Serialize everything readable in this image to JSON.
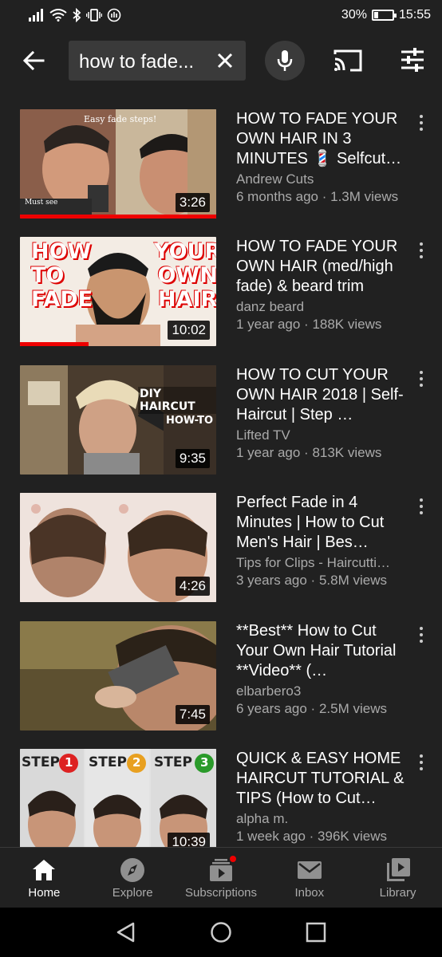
{
  "status_bar": {
    "signal": "4G",
    "battery_percent_label": "30%",
    "battery_level": 0.3,
    "time": "15:55"
  },
  "search": {
    "query": "how to fade..."
  },
  "results": [
    {
      "title": "HOW TO FADE YOUR OWN HAIR IN 3 MINUTES 💈 Selfcut…",
      "channel": "Andrew Cuts",
      "meta": "6 months ago · 1.3M views",
      "duration": "3:26",
      "watched_fraction": 1.0,
      "thumb_overlay": [
        "Easy fade steps!",
        "Must see"
      ]
    },
    {
      "title": "HOW TO FADE YOUR OWN HAIR (med/high fade) & beard trim",
      "channel": "danz beard",
      "meta": "1 year ago · 188K views",
      "duration": "10:02",
      "watched_fraction": 0.35,
      "thumb_overlay": [
        "HOW",
        "TO",
        "FADE",
        "YOUR",
        "OWN",
        "HAIR"
      ]
    },
    {
      "title": "HOW TO CUT YOUR OWN HAIR 2018 | Self-Haircut | Step …",
      "channel": "Lifted TV",
      "meta": "1 year ago · 813K views",
      "duration": "9:35",
      "watched_fraction": 0,
      "thumb_overlay": [
        "DIY HAIRCUT",
        "HOW-TO"
      ]
    },
    {
      "title": "Perfect Fade in 4 Minutes | How to Cut Men's Hair | Bes…",
      "channel": "Tips for Clips - Haircutti…",
      "meta": "3 years ago · 5.8M views",
      "duration": "4:26",
      "watched_fraction": 0,
      "thumb_overlay": []
    },
    {
      "title": "**Best** How to Cut Your Own Hair Tutorial **Video** (…",
      "channel": "elbarbero3",
      "meta": "6 years ago · 2.5M views",
      "duration": "7:45",
      "watched_fraction": 0,
      "thumb_overlay": []
    },
    {
      "title": "QUICK & EASY HOME HAIRCUT TUTORIAL & TIPS (How to Cut…",
      "channel": "alpha m.",
      "meta": "1 week ago · 396K views",
      "duration": "10:39",
      "watched_fraction": 0,
      "thumb_overlay": [
        "STEP",
        "1",
        "STEP",
        "2",
        "STEP",
        "3"
      ]
    }
  ],
  "bottom_nav": [
    {
      "label": "Home",
      "icon": "home-icon",
      "active": true
    },
    {
      "label": "Explore",
      "icon": "explore-icon",
      "active": false
    },
    {
      "label": "Subscriptions",
      "icon": "subscriptions-icon",
      "active": false
    },
    {
      "label": "Inbox",
      "icon": "inbox-icon",
      "active": false
    },
    {
      "label": "Library",
      "icon": "library-icon",
      "active": false
    }
  ],
  "colors": {
    "background": "#212121",
    "accent_red": "#ee0000",
    "text_secondary": "#aaaaaa"
  }
}
